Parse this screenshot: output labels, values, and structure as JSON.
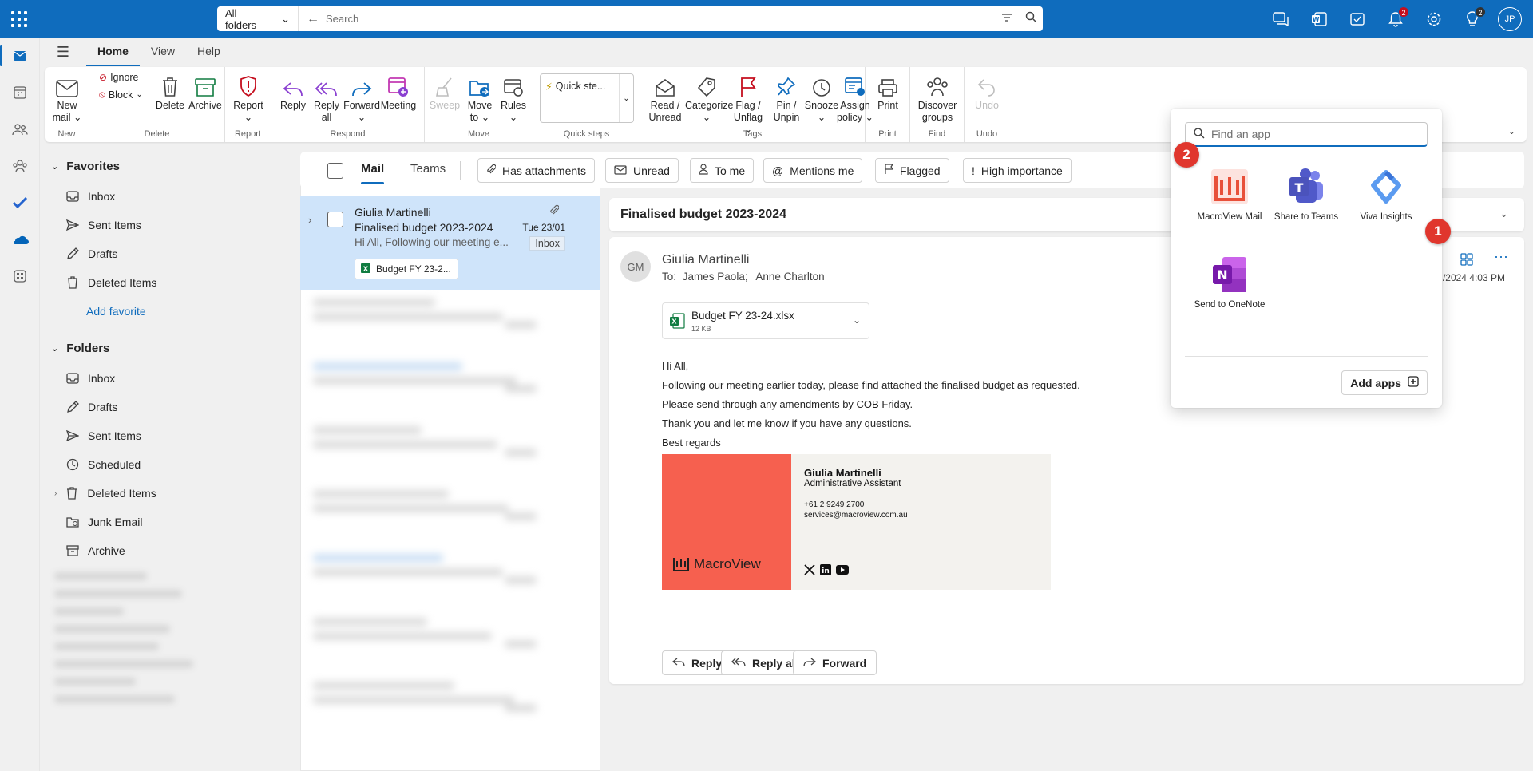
{
  "topbar": {
    "scope": "All folders",
    "search_placeholder": "Search",
    "notifications_count": "2",
    "help_count": "2",
    "avatar_initials": "JP"
  },
  "ribbon_tabs": [
    "Home",
    "View",
    "Help"
  ],
  "ribbon": {
    "new_mail": [
      "New",
      "mail"
    ],
    "ignore": "Ignore",
    "block": "Block",
    "delete": "Delete",
    "archive": "Archive",
    "report": "Report",
    "reply": "Reply",
    "reply_all": [
      "Reply",
      "all"
    ],
    "forward": "Forward",
    "meeting": "Meeting",
    "sweep": "Sweep",
    "move_to": [
      "Move",
      "to"
    ],
    "rules": "Rules",
    "quick_steps": "Quick ste...",
    "read_unread": [
      "Read /",
      "Unread"
    ],
    "categorize": "Categorize",
    "flag_unflag": [
      "Flag /",
      "Unflag"
    ],
    "pin_unpin": [
      "Pin /",
      "Unpin"
    ],
    "snooze": "Snooze",
    "assign_policy": [
      "Assign",
      "policy"
    ],
    "print": "Print",
    "discover_groups": [
      "Discover",
      "groups"
    ],
    "undo": "Undo",
    "groups": {
      "new": "New",
      "delete": "Delete",
      "report": "Report",
      "respond": "Respond",
      "move": "Move",
      "quick_steps": "Quick steps",
      "tags": "Tags",
      "print": "Print",
      "find": "Find",
      "undo": "Undo"
    }
  },
  "folders": {
    "favorites_header": "Favorites",
    "favorites": [
      "Inbox",
      "Sent Items",
      "Drafts",
      "Deleted Items"
    ],
    "add_favorite": "Add favorite",
    "folders_header": "Folders",
    "items": [
      "Inbox",
      "Drafts",
      "Sent Items",
      "Scheduled",
      "Deleted Items",
      "Junk Email",
      "Archive"
    ]
  },
  "filterbar": {
    "tabs": [
      "Mail",
      "Teams"
    ],
    "chips": [
      "Has attachments",
      "Unread",
      "To me",
      "Mentions me",
      "Flagged",
      "High importance"
    ]
  },
  "message": {
    "from": "Giulia Martinelli",
    "subject": "Finalised budget 2023-2024",
    "preview": "Hi All, Following our meeting e...",
    "date": "Tue 23/01",
    "folder_tag": "Inbox",
    "attachment": "Budget FY 23-2..."
  },
  "reading": {
    "subject": "Finalised budget 2023-2024",
    "avatar": "GM",
    "sender": "Giulia Martinelli",
    "to_label": "To:",
    "to": [
      "James Paola;",
      "Anne Charlton"
    ],
    "date": "/2024 4:03 PM",
    "attachment_name": "Budget FY 23-24.xlsx",
    "attachment_size": "12 KB",
    "body": [
      "Hi All,",
      "Following our meeting earlier today, please find attached the finalised budget as requested.",
      "Please send through any amendments by COB Friday.",
      "Thank you and let me know if you have any questions.",
      "Best regards"
    ],
    "signature": {
      "name": "Giulia Martinelli",
      "title": "Administrative Assistant",
      "phone": "+61 2 9249 2700",
      "email": "services@macroview.com.au",
      "logo_text": "MacroView"
    },
    "actions": [
      "Reply",
      "Reply all",
      "Forward"
    ]
  },
  "app_flyout": {
    "search_placeholder": "Find an app",
    "apps": [
      "MacroView Mail",
      "Share to Teams",
      "Viva Insights",
      "Send to OneNote"
    ],
    "add_apps": "Add apps"
  },
  "callouts": [
    "1",
    "2"
  ],
  "colors": {
    "brand": "#0f6cbd",
    "selected_row": "#cfe4fa",
    "callout": "#e0362d",
    "signature_accent": "#f6604f"
  }
}
